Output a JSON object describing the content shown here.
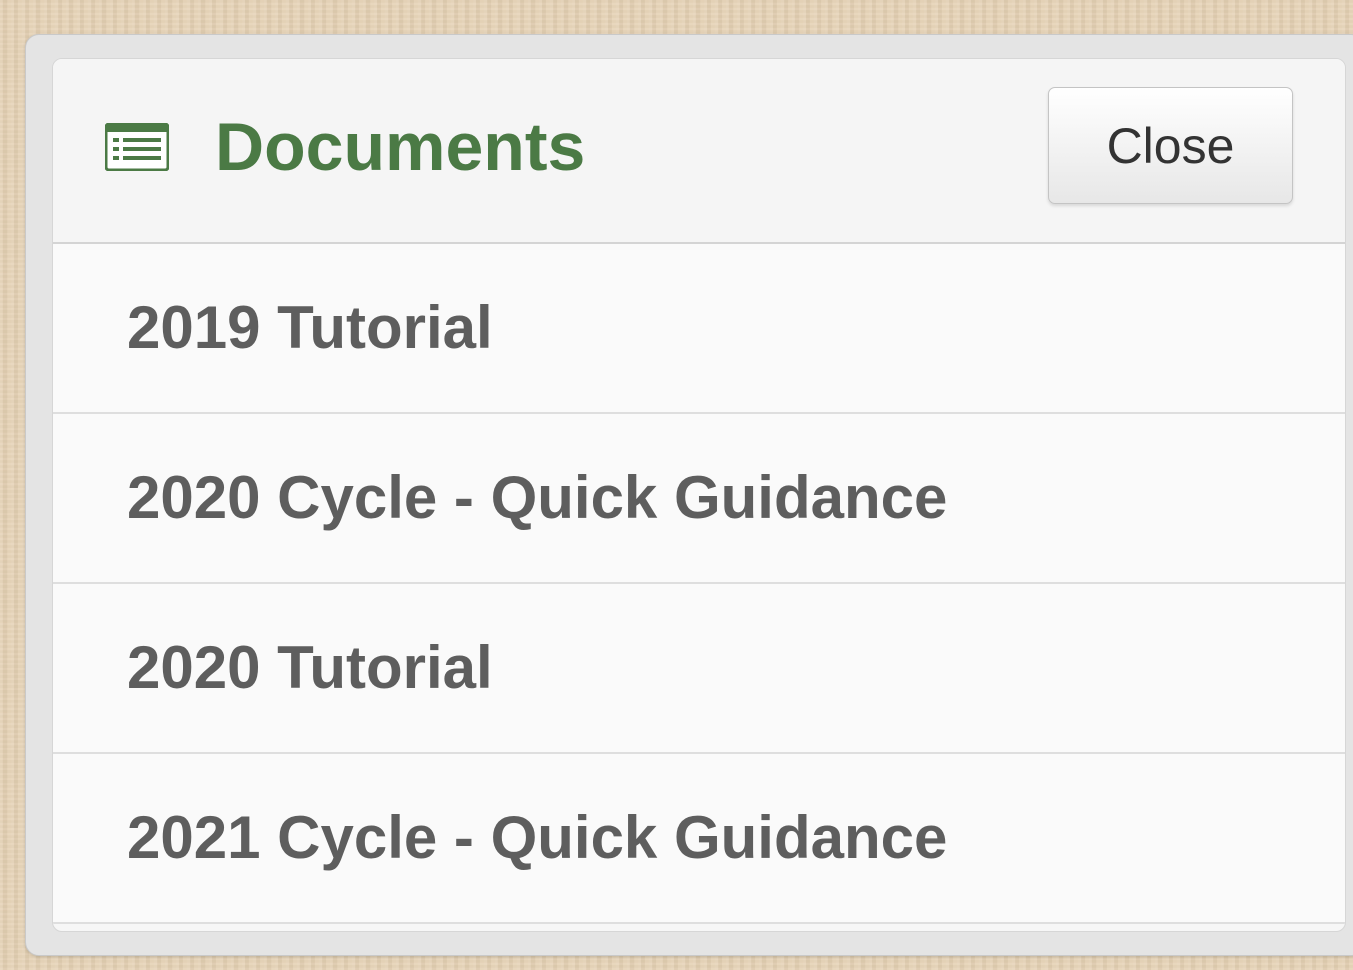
{
  "panel": {
    "title": "Documents",
    "title_icon": "list-icon",
    "close_label": "Close"
  },
  "documents": [
    {
      "label": "2019 Tutorial"
    },
    {
      "label": "2020 Cycle - Quick Guidance"
    },
    {
      "label": "2020 Tutorial"
    },
    {
      "label": "2021 Cycle - Quick Guidance"
    }
  ],
  "colors": {
    "title": "#4b7a45",
    "item_text": "#5e5e5e",
    "background": "#e6d2b5"
  }
}
